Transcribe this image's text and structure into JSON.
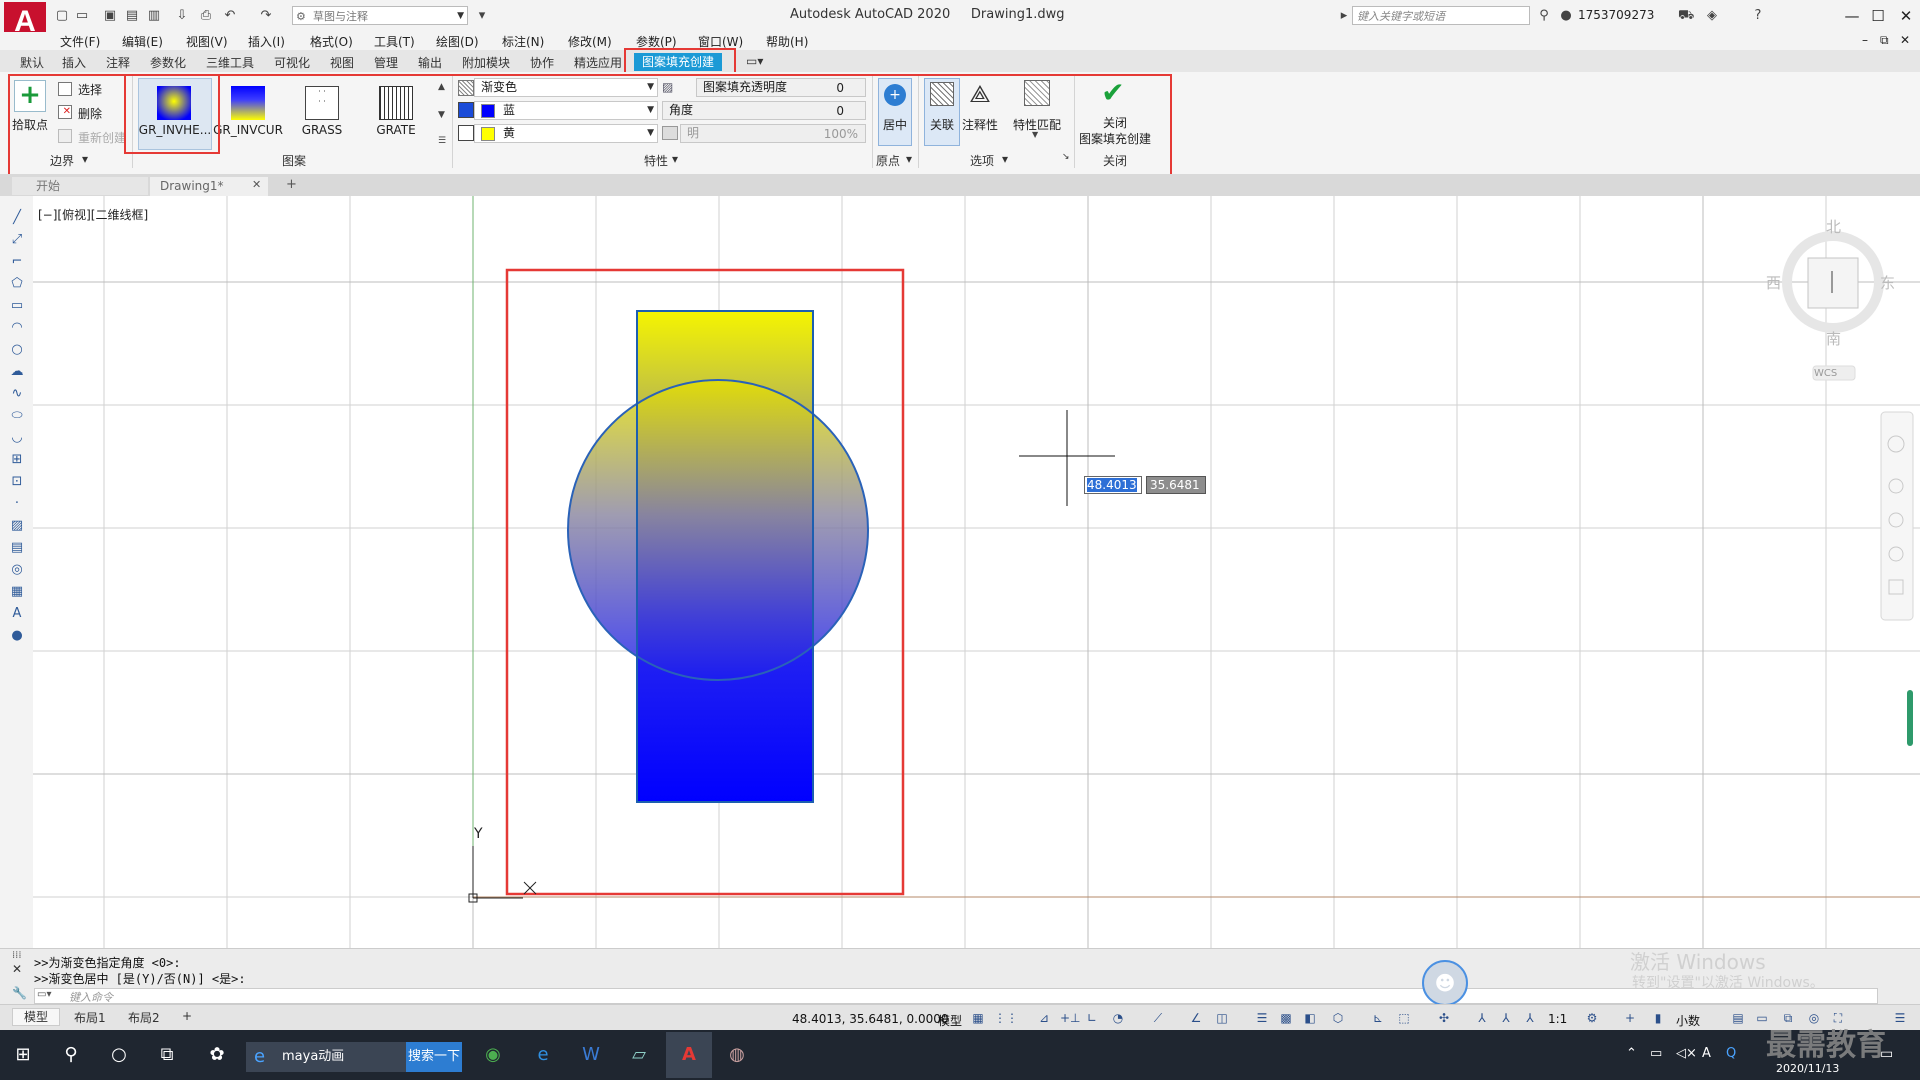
{
  "app": {
    "window_title": "Autodesk AutoCAD 2020     Drawing1.dwg",
    "workspace": "草图与注释",
    "search_placeholder": "键入关键字或短语",
    "user": "1753709273"
  },
  "menu": [
    "文件(F)",
    "编辑(E)",
    "视图(V)",
    "插入(I)",
    "格式(O)",
    "工具(T)",
    "绘图(D)",
    "标注(N)",
    "修改(M)",
    "参数(P)",
    "窗口(W)",
    "帮助(H)"
  ],
  "ribbon_tabs": [
    "默认",
    "插入",
    "注释",
    "参数化",
    "三维工具",
    "可视化",
    "视图",
    "管理",
    "输出",
    "附加模块",
    "协作",
    "精选应用"
  ],
  "active_tab": "图案填充创建",
  "boundary": {
    "pick_points": "拾取点",
    "select": "选择",
    "remove": "删除",
    "recreate": "重新创建",
    "title": "边界"
  },
  "patterns": {
    "items": [
      "GR_INVHE...",
      "GR_INVCUR",
      "GRASS",
      "GRATE"
    ],
    "title": "图案"
  },
  "properties": {
    "type": "渐变色",
    "color1": "蓝",
    "color2": "黄",
    "transparency_label": "图案填充透明度",
    "transparency_value": "0",
    "angle_label": "角度",
    "angle_value": "0",
    "tint_label": "明",
    "tint_value": "100%",
    "title": "特性",
    "color1_hex": "#0000ff",
    "color2_hex": "#ffff00"
  },
  "origin": {
    "center": "居中",
    "title": "原点"
  },
  "options": {
    "associative": "关联",
    "annotative": "注释性",
    "match": "特性匹配",
    "title": "选项"
  },
  "close": {
    "label_line1": "关闭",
    "label_line2": "图案填充创建",
    "title": "关闭"
  },
  "file_tabs": [
    "开始",
    "Drawing1*"
  ],
  "viewport": {
    "label": "[−][俯视][二维线框]",
    "cursor_x": "48.4013",
    "cursor_y": "35.6481",
    "ucs_y": "Y",
    "ucs_x": "X"
  },
  "viewcube": {
    "north": "北",
    "south": "南",
    "east": "东",
    "west": "西",
    "wcs": "WCS"
  },
  "command_history": [
    ">>为渐变色指定角度 <0>:",
    ">>渐变色居中 [是(Y)/否(N)] <是>:"
  ],
  "command_placeholder": "键入命令",
  "layout_tabs": [
    "模型",
    "布局1",
    "布局2",
    "+"
  ],
  "status": {
    "coords": "48.4013, 35.6481, 0.0000",
    "model": "模型",
    "scale": "1:1",
    "units": "小数"
  },
  "taskbar": {
    "ie_app": "maya动画",
    "search_btn": "搜索一下",
    "date": "2020/11/13"
  },
  "watermark": {
    "line1": "激活 Windows",
    "line2": "转到\"设置\"以激活 Windows。"
  },
  "brand": "最需教育"
}
